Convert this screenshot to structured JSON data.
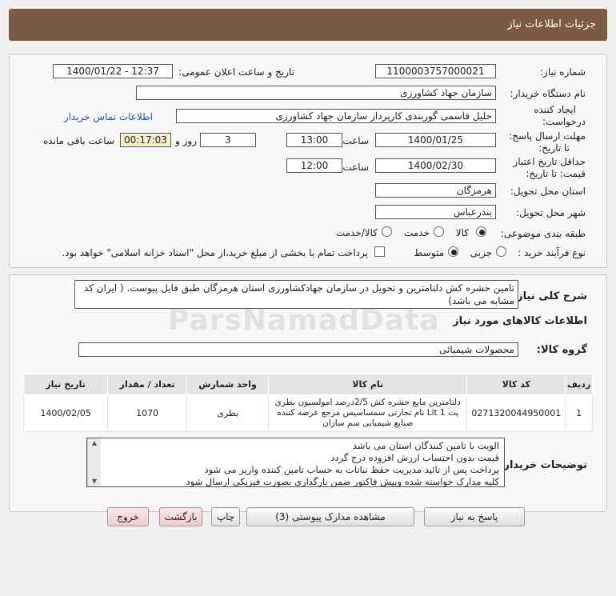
{
  "header": {
    "title": "جزئیات اطلاعات نیاز"
  },
  "info": {
    "need_number_label": "شماره نیاز:",
    "need_number": "1100003757000021",
    "announce_label": "تاریخ و ساعت اعلان عمومی:",
    "announce_value": "1400/01/22 - 12:37",
    "buyer_org_label": "نام دستگاه خریدار:",
    "buyer_org": "سازمان جهاد کشاورزی",
    "creator_label_1": "ایجاد کننده",
    "creator_label_2": "درخواست:",
    "creator": "خلیل قاسمی گوربندی کارپرداز سازمان جهاد کشاورزی",
    "contact_link": "اطلاعات تماس خریدار",
    "send_deadline_label_1": "مهلت ارسال پاسخ:",
    "send_deadline_label_2": "تا تاریخ:",
    "send_date": "1400/01/25",
    "time_label": "ساعت",
    "send_time": "13:00",
    "days_value": "3",
    "days_label": "روز و",
    "remaining_time": "00:17:03",
    "remaining_label": "ساعت باقی مانده",
    "validity_label_1": "حداقل تاریخ اعتبار",
    "validity_label_2": "قیمت: تا تاریخ:",
    "validity_date": "1400/02/30",
    "validity_time": "12:00",
    "province_label": "استان محل تحویل:",
    "province": "هرمزگان",
    "city_label": "شهر محل تحویل:",
    "city": "بندرعباس",
    "category_label": "طبقه بندی موضوعی:",
    "cat_goods": "کالا",
    "cat_service": "خدمت",
    "cat_goods_service": "کالا/خدمت",
    "purchase_type_label": "نوع فرآیند خرید :",
    "pt_small": "جزیی",
    "pt_medium": "متوسط",
    "payment_note": "پرداخت تمام یا بخشی از مبلغ خرید،از محل \"اسناد خزانه اسلامی\" خواهد بود."
  },
  "description": {
    "label": "شرح کلی نیاز:",
    "text": "تامین حشره کش دلتامترین و تحویل در سازمان جهادکشاورزی استان هرمزگان طبق فایل پیوست. ( ایران کد مشابه می باشد)"
  },
  "goods": {
    "section_title": "اطلاعات کالاهای مورد نیاز",
    "group_label": "گروه کالا:",
    "group_value": "محصولات شیمیائی",
    "columns": [
      "ردیف",
      "کد کالا",
      "نام کالا",
      "واحد شمارش",
      "تعداد / مقدار",
      "تاریخ نیاز"
    ],
    "rows": [
      {
        "row": "1",
        "code": "0271320044950001",
        "name": "دلتامترین مایع حشره کش 2/5درصد امولسیون بطری پت 1 Lit نام تجارتی سمساسیس مرجع عرضه کننده صنایع شیمیایی سم سازان",
        "unit": "بطری",
        "qty": "1070",
        "date": "1400/02/05"
      }
    ]
  },
  "notes": {
    "label": "توضیحات خریدار:",
    "lines": [
      "الویت با تامین کنندگان استان می باشد",
      "قیمت بدون احتساب ارزش افزوده درج گردد",
      "پرداخت پس از تائید مدیریت حفظ نباتات به حساب تامین کننده واریز می شود",
      "کلیه مدارک خواسته شده وپیش فاکتور ضمن بارگذاری بصورت فیزیکی ارسال شود"
    ]
  },
  "buttons": {
    "reply": "پاسخ به نیاز",
    "attachments": "مشاهده مدارک پیوستی (3)",
    "print": "چاپ",
    "back": "بازگشت",
    "exit": "خروج"
  },
  "watermark": "ParsNamadData"
}
